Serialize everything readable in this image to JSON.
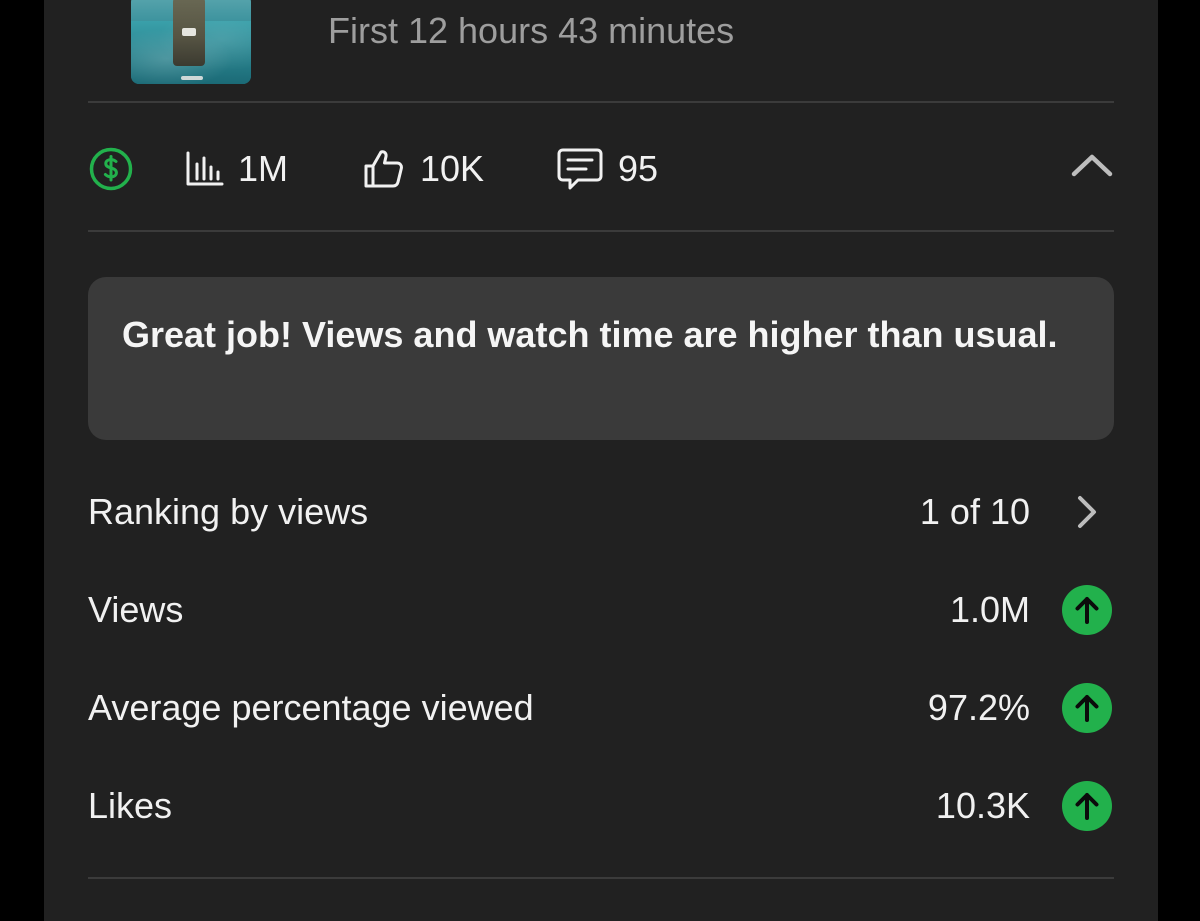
{
  "video": {
    "subtitle": "First 12 hours 43 minutes"
  },
  "stats": {
    "views": "1M",
    "likes": "10K",
    "comments": "95"
  },
  "banner": {
    "text": "Great job! Views and watch time are higher than usual."
  },
  "metrics": [
    {
      "label": "Ranking by views",
      "value": "1 of 10",
      "trail": "chevron-right-icon"
    },
    {
      "label": "Views",
      "value": "1.0M",
      "trail": "arrow-up-icon"
    },
    {
      "label": "Average percentage viewed",
      "value": "97.2%",
      "trail": "arrow-up-icon"
    },
    {
      "label": "Likes",
      "value": "10.3K",
      "trail": "arrow-up-icon"
    }
  ],
  "colors": {
    "background": "#212121",
    "accent_green": "#22b14c",
    "divider": "#3b3b3b",
    "banner": "#3a3a3a"
  }
}
